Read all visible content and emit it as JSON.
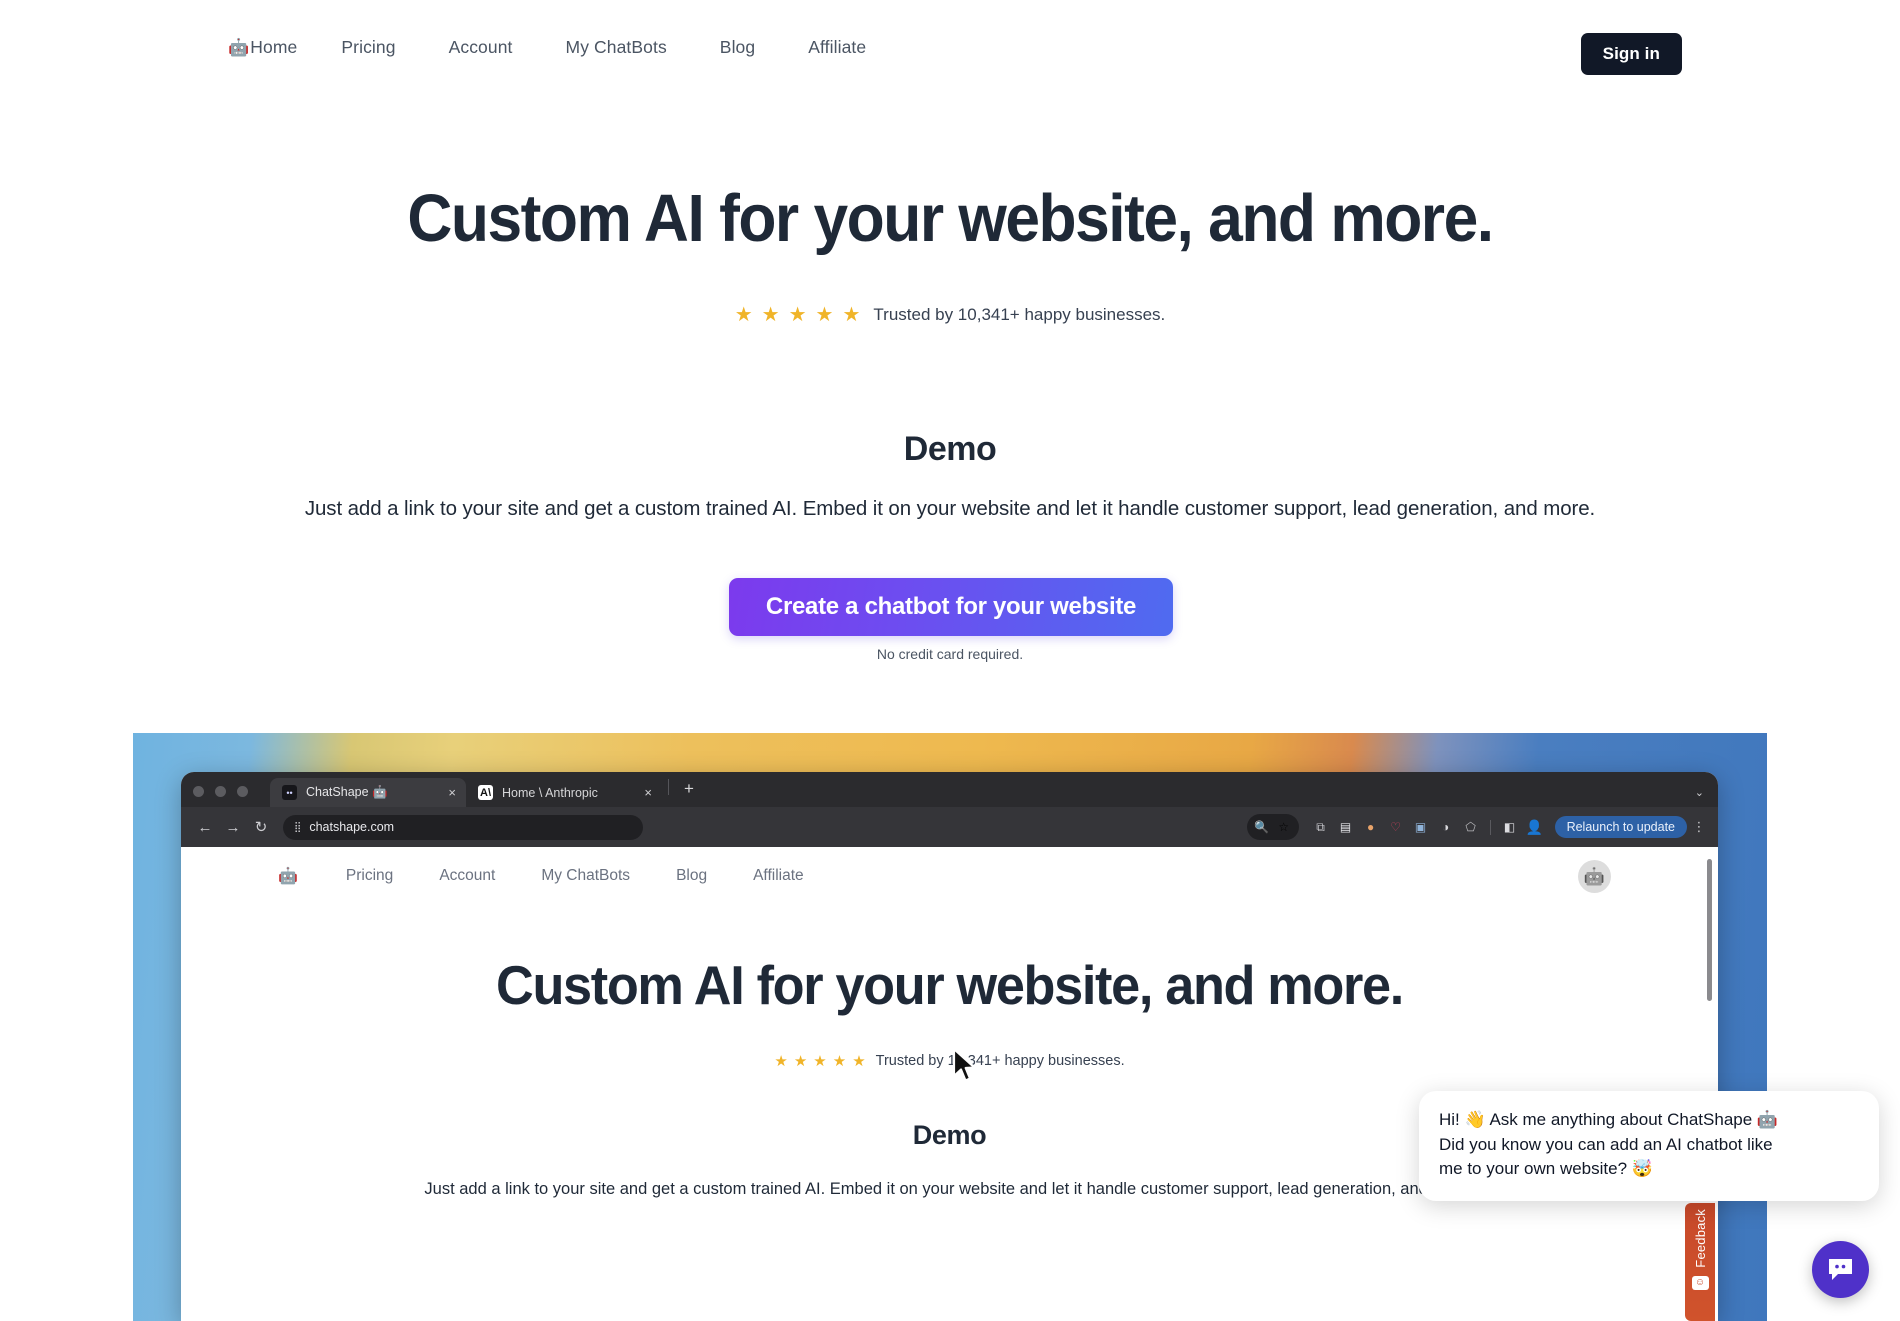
{
  "topnav": {
    "logo_icon": "robot-emoji",
    "logo_glyph": "🤖",
    "links": [
      {
        "label": "Home",
        "name": "home"
      },
      {
        "label": "Pricing",
        "name": "pricing"
      },
      {
        "label": "Account",
        "name": "account"
      },
      {
        "label": "My ChatBots",
        "name": "my-chatbots"
      },
      {
        "label": "Blog",
        "name": "blog"
      },
      {
        "label": "Affiliate",
        "name": "affiliate"
      }
    ],
    "signin_label": "Sign in"
  },
  "hero": {
    "title": "Custom AI for your website, and more.",
    "stars": [
      "★",
      "★",
      "★",
      "★",
      "★"
    ],
    "star_color": "#f0b429",
    "rating_text": "Trusted by 10,341+ happy businesses.",
    "demo_heading": "Demo",
    "demo_subtext": "Just add a link to your site and get a custom trained AI. Embed it on your website and let it handle customer support, lead generation, and more.",
    "cta_label": "Create a chatbot for your website",
    "cta_note": "No credit card required.",
    "cta_gradient_from": "#7c3aed",
    "cta_gradient_to": "#4f6bf0"
  },
  "browser": {
    "tabs": [
      {
        "title": "ChatShape 🤖",
        "favicon": "chatshape-icon",
        "active": true,
        "close": "×"
      },
      {
        "title": "Home \\ Anthropic",
        "favicon": "anthropic-icon",
        "active": false,
        "close": "×"
      }
    ],
    "new_tab": "+",
    "window_caret": "⌄",
    "nav_back": "←",
    "nav_forward": "→",
    "nav_reload": "↻",
    "url": "chatshape.com",
    "url_icon": "tune-icon",
    "zoom_icon": "🔍",
    "bookmark_icon": "☆",
    "extensions": [
      {
        "name": "screenshot-extension",
        "glyph": "⧉",
        "color": "#cdcdd1"
      },
      {
        "name": "columns-extension",
        "glyph": "▤",
        "color": "#e2e2e6"
      },
      {
        "name": "capsule-extension",
        "glyph": "●",
        "color": "#e8a36a"
      },
      {
        "name": "pocket-extension",
        "glyph": "♡",
        "color": "#d4415e"
      },
      {
        "name": "photo-extension",
        "glyph": "▣",
        "color": "#8fb3d9"
      },
      {
        "name": "swirl-extension",
        "glyph": "◑",
        "color": "#d8d8dc"
      },
      {
        "name": "shield-extension",
        "glyph": "⬠",
        "color": "#b9b9bd"
      },
      {
        "name": "sidepanel-icon",
        "glyph": "◧",
        "color": "#dcdce0"
      },
      {
        "name": "profile-avatar",
        "glyph": "👤",
        "color": "#d8c9a0"
      }
    ],
    "relaunch_label": "Relaunch to update",
    "relaunch_color": "#2d61a6",
    "kebab": "⋮"
  },
  "inner_page": {
    "logo_glyph": "🤖",
    "links": [
      {
        "label": "Pricing"
      },
      {
        "label": "Account"
      },
      {
        "label": "My ChatBots"
      },
      {
        "label": "Blog"
      },
      {
        "label": "Affiliate"
      }
    ],
    "avatar_icon": "robot-avatar",
    "avatar_glyph": "🤖",
    "title": "Custom AI for your website, and more.",
    "stars": [
      "★",
      "★",
      "★",
      "★",
      "★"
    ],
    "rating_text": "Trusted by 10,341+ happy businesses.",
    "demo_heading": "Demo",
    "demo_subtext": "Just add a link to your site and get a custom trained AI. Embed it on your website and let it handle customer support, lead generation, and more."
  },
  "chat_widget": {
    "message_line1": "Hi! 👋 Ask me anything about ChatShape 🤖",
    "message_line2": "Did you know you can add an AI chatbot like",
    "message_line3": "me to your own website? 🤯",
    "fab_icon": "chat-bubble-icon",
    "fab_color": "#4f31c9"
  },
  "feedback": {
    "label": "Feedback",
    "icon": "smiley-face-icon",
    "color": "#c8492a"
  }
}
